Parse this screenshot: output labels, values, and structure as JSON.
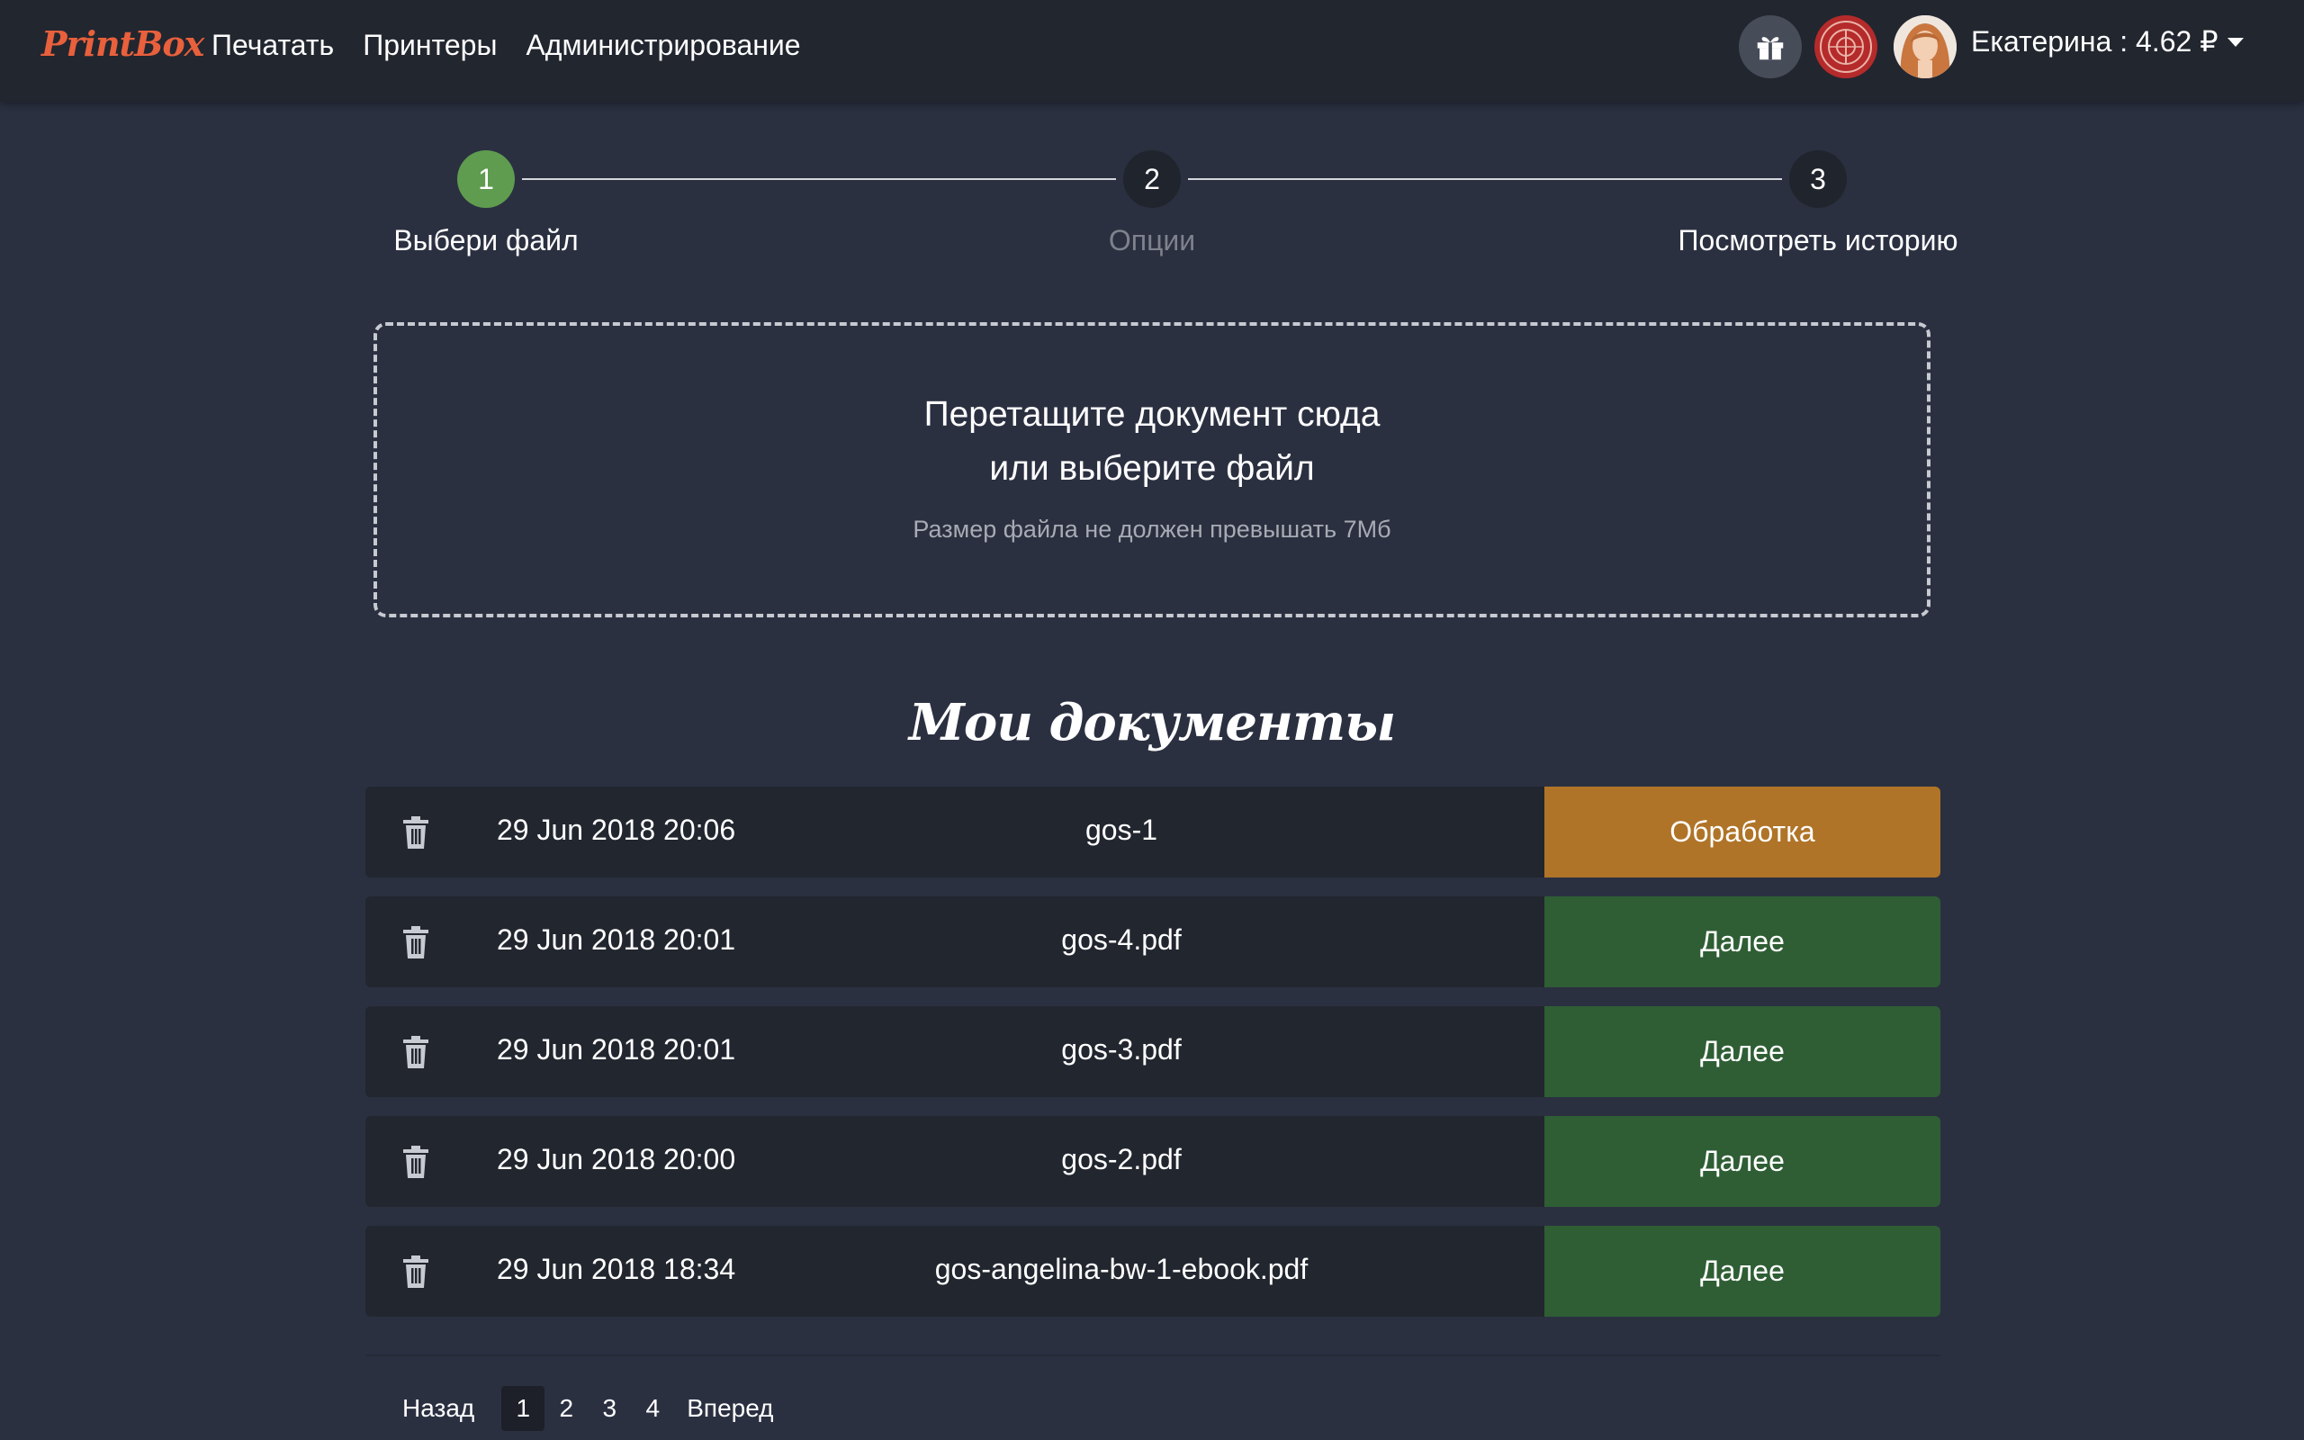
{
  "brand": "PrintBox",
  "nav": {
    "links": [
      "Печатать",
      "Принтеры",
      "Администрирование"
    ]
  },
  "user": {
    "label": "Екатерина : 4.62 ₽"
  },
  "icons": {
    "gift": "gift-icon",
    "org": "organization-logo",
    "avatar": "user-avatar",
    "trash": "trash-icon",
    "caret": "caret-down-icon"
  },
  "stepper": {
    "steps": [
      {
        "number": "1",
        "label": "Выбери файл",
        "state": "active"
      },
      {
        "number": "2",
        "label": "Опции",
        "state": "disabled"
      },
      {
        "number": "3",
        "label": "Посмотреть историю",
        "state": "inactive"
      }
    ]
  },
  "dropzone": {
    "line1": "Перетащите документ сюда",
    "line2": "или выберите файл",
    "note": "Размер файла не должен превышать 7Мб"
  },
  "documents": {
    "title": "Мои документы",
    "rows": [
      {
        "date": "29 Jun 2018 20:06",
        "name": "gos-1",
        "action": "Обработка",
        "status": "processing"
      },
      {
        "date": "29 Jun 2018 20:01",
        "name": "gos-4.pdf",
        "action": "Далее",
        "status": "ready"
      },
      {
        "date": "29 Jun 2018 20:01",
        "name": "gos-3.pdf",
        "action": "Далее",
        "status": "ready"
      },
      {
        "date": "29 Jun 2018 20:00",
        "name": "gos-2.pdf",
        "action": "Далее",
        "status": "ready"
      },
      {
        "date": "29 Jun 2018 18:34",
        "name": "gos-angelina-bw-1-ebook.pdf",
        "action": "Далее",
        "status": "ready"
      }
    ]
  },
  "pagination": {
    "prev": "Назад",
    "pages": [
      "1",
      "2",
      "3",
      "4"
    ],
    "current": "1",
    "next": "Вперед"
  },
  "colors": {
    "background": "#2b3041",
    "navbar": "#22262f",
    "row": "#22262f",
    "brand": "#e8603c",
    "step_active": "#5f9c4f",
    "processing": "#b07428",
    "ready": "#2f5e35",
    "org_logo": "#b52a2a"
  }
}
